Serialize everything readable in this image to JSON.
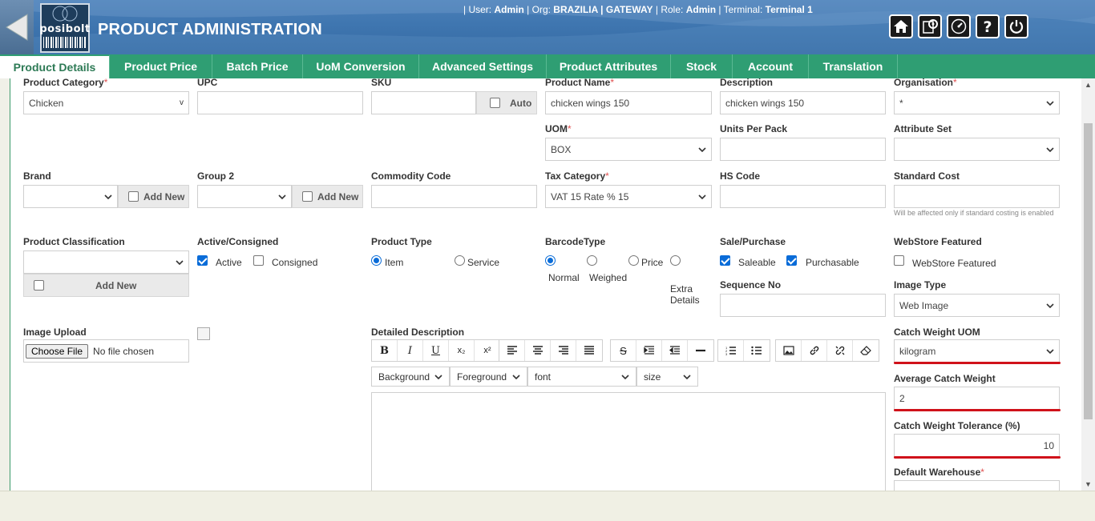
{
  "header": {
    "title": "PRODUCT ADMINISTRATION",
    "logo_text": "posibolt",
    "user_label": "| User:",
    "user": "Admin",
    "org_label": "| Org:",
    "org": "BRAZILIA | GATEWAY",
    "role_label": "| Role:",
    "role": "Admin",
    "terminal_label": "| Terminal:",
    "terminal": "Terminal 1",
    "icons": [
      "home-icon",
      "settings-icon",
      "dashboard-icon",
      "help-icon",
      "power-icon"
    ]
  },
  "tabs": [
    "Product Details",
    "Product Price",
    "Batch Price",
    "UoM Conversion",
    "Advanced Settings",
    "Product Attributes",
    "Stock",
    "Account",
    "Translation"
  ],
  "form": {
    "product_category": {
      "label": "Product Category",
      "value": "Chicken"
    },
    "upc": {
      "label": "UPC",
      "value": ""
    },
    "sku": {
      "label": "SKU",
      "value": "",
      "auto_label": "Auto"
    },
    "product_name": {
      "label": "Product Name",
      "value": "chicken wings 150"
    },
    "description": {
      "label": "Description",
      "value": "chicken wings 150"
    },
    "organisation": {
      "label": "Organisation",
      "value": "*"
    },
    "uom": {
      "label": "UOM",
      "value": "BOX"
    },
    "units_per_pack": {
      "label": "Units Per Pack",
      "value": ""
    },
    "attribute_set": {
      "label": "Attribute Set",
      "value": ""
    },
    "brand": {
      "label": "Brand",
      "value": "",
      "add_new": "Add New"
    },
    "group2": {
      "label": "Group 2",
      "value": "",
      "add_new": "Add New"
    },
    "commodity_code": {
      "label": "Commodity Code",
      "value": ""
    },
    "tax_category": {
      "label": "Tax Category",
      "value": "VAT 15 Rate % 15"
    },
    "hs_code": {
      "label": "HS Code",
      "value": ""
    },
    "standard_cost": {
      "label": "Standard Cost",
      "value": "",
      "hint": "Will be affected only if standard costing is enabled"
    },
    "product_classification": {
      "label": "Product Classification",
      "value": "",
      "add_new": "Add New"
    },
    "active_consigned": {
      "label": "Active/Consigned",
      "active": "Active",
      "consigned": "Consigned"
    },
    "product_type": {
      "label": "Product Type",
      "item": "Item",
      "service": "Service"
    },
    "barcode_type": {
      "label": "BarcodeType",
      "normal": "Normal",
      "weighed": "Weighed",
      "price": "Price",
      "extra_line1": "Extra",
      "extra_line2": "Details"
    },
    "sale_purchase": {
      "label": "Sale/Purchase",
      "saleable": "Saleable",
      "purchasable": "Purchasable"
    },
    "sequence_no": {
      "label": "Sequence No",
      "value": ""
    },
    "webstore": {
      "label": "WebStore Featured",
      "option": "WebStore Featured"
    },
    "image_type": {
      "label": "Image Type",
      "value": "Web Image"
    },
    "image_upload": {
      "label": "Image Upload",
      "button": "Choose File",
      "status": "No file chosen"
    },
    "detailed_description": {
      "label": "Detailed Description"
    },
    "editor": {
      "background": "Background",
      "foreground": "Foreground",
      "font": "font",
      "size": "size"
    },
    "catch_weight_uom": {
      "label": "Catch Weight UOM",
      "value": "kilogram"
    },
    "average_catch_weight": {
      "label": "Average Catch Weight",
      "value": "2"
    },
    "catch_weight_tolerance": {
      "label": "Catch Weight Tolerance (%)",
      "value": "10"
    },
    "default_warehouse": {
      "label": "Default Warehouse"
    }
  },
  "colors": {
    "tab_green": "#2f9e73",
    "header_blue": "#3f76b0",
    "highlight_red": "#d0121a",
    "checkbox_blue": "#0a6cd8"
  }
}
